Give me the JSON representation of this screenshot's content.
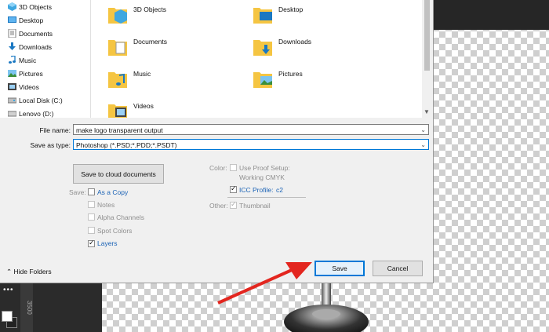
{
  "nav": {
    "items": [
      {
        "label": "3D Objects",
        "icon": "3d-objects-icon"
      },
      {
        "label": "Desktop",
        "icon": "desktop-icon"
      },
      {
        "label": "Documents",
        "icon": "documents-icon"
      },
      {
        "label": "Downloads",
        "icon": "downloads-icon"
      },
      {
        "label": "Music",
        "icon": "music-icon"
      },
      {
        "label": "Pictures",
        "icon": "pictures-icon"
      },
      {
        "label": "Videos",
        "icon": "videos-icon"
      },
      {
        "label": "Local Disk (C:)",
        "icon": "local-disk-icon"
      },
      {
        "label": "Lenovo (D:)",
        "icon": "drive-icon"
      }
    ]
  },
  "files": [
    {
      "label": "3D Objects"
    },
    {
      "label": "Desktop"
    },
    {
      "label": "Documents"
    },
    {
      "label": "Downloads"
    },
    {
      "label": "Music"
    },
    {
      "label": "Pictures"
    },
    {
      "label": "Videos"
    }
  ],
  "form": {
    "file_name_label": "File name:",
    "file_name_value": "make logo transparent output",
    "save_type_label": "Save as type:",
    "save_type_value": "Photoshop (*.PSD;*.PDD;*.PSDT)"
  },
  "options": {
    "cloud_button": "Save to cloud documents",
    "save_label": "Save:",
    "as_copy": "As a Copy",
    "notes": "Notes",
    "alpha_channels": "Alpha Channels",
    "spot_colors": "Spot Colors",
    "layers": "Layers",
    "color_label": "Color:",
    "use_proof_setup": "Use Proof Setup:",
    "working_cmyk": "Working CMYK",
    "icc_profile": "ICC Profile:",
    "icc_value": "c2",
    "other_label": "Other:",
    "thumbnail": "Thumbnail"
  },
  "footer": {
    "hide_folders": "Hide Folders",
    "save_button": "Save",
    "cancel_button": "Cancel"
  },
  "ruler": {
    "text": "3500"
  },
  "colors": {
    "accent": "#0078d7",
    "arrow": "#e3261f",
    "folder": "#f5c542"
  }
}
